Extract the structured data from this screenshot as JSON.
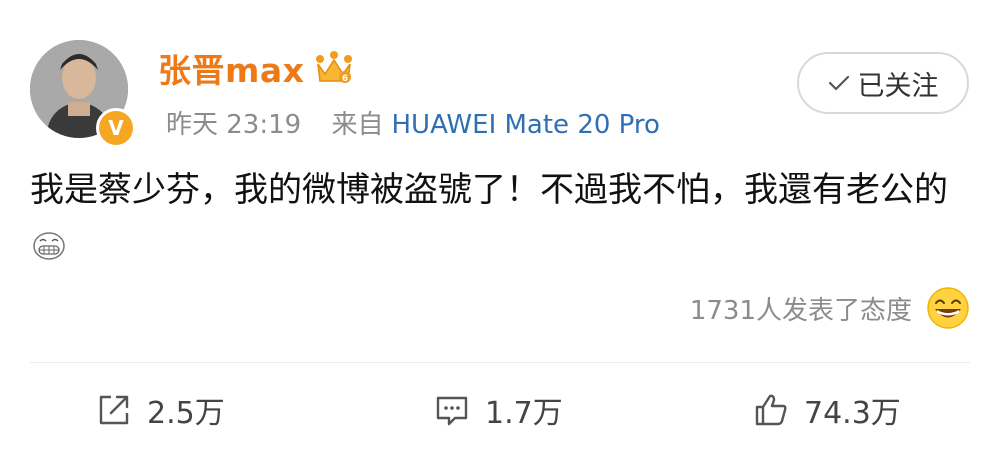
{
  "post": {
    "username": "张晋max",
    "time": "昨天 23:19",
    "source_prefix": "来自",
    "source": "HUAWEI Mate 20 Pro",
    "follow_label": "已关注",
    "content": "我是蔡少芬，我的微博被盗號了！不過我不怕，我還有老公的",
    "reaction_summary": "1731人发表了态度"
  },
  "actions": {
    "repost_count": "2.5万",
    "comment_count": "1.7万",
    "like_count": "74.3万"
  },
  "colors": {
    "username": "#ee7a17",
    "source": "#2f6fb3",
    "verified_badge": "#f5a623"
  },
  "icons": [
    "crown-badge-icon",
    "verified-icon",
    "check-icon",
    "grin-emoji-icon",
    "laugh-emoji-icon",
    "repost-icon",
    "comment-icon",
    "like-icon"
  ]
}
